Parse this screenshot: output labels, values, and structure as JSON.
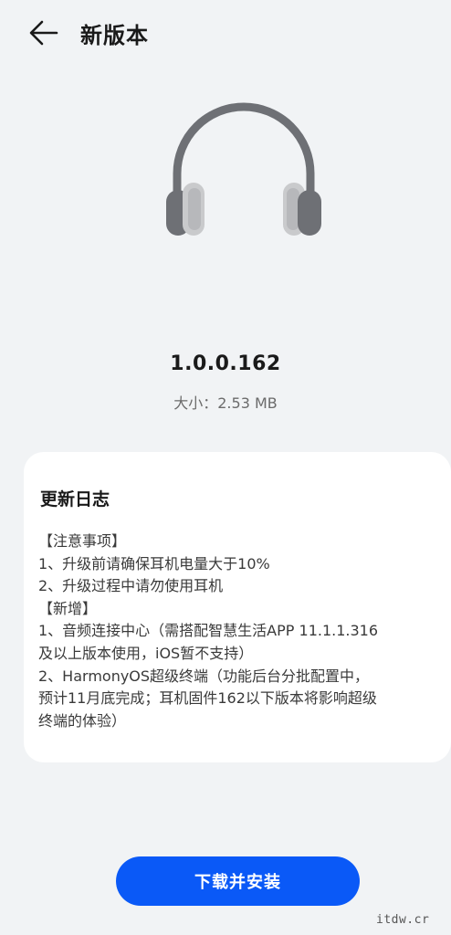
{
  "header": {
    "back_icon": "arrow-left-icon",
    "title": "新版本"
  },
  "hero": {
    "icon": "headphones-icon"
  },
  "release": {
    "version": "1.0.0.162",
    "size_text": "大小：2.53 MB"
  },
  "changelog": {
    "title": "更新日志",
    "lines": [
      "【注意事项】",
      "1、升级前请确保耳机电量大于10%",
      "2、升级过程中请勿使用耳机",
      "【新增】",
      "1、音频连接中心（需搭配智慧生活APP 11.1.1.316",
      "及以上版本使用，iOS暂不支持）",
      "2、HarmonyOS超级终端（功能后台分批配置中，",
      "预计11月底完成；耳机固件162以下版本将影响超级",
      "终端的体验）"
    ]
  },
  "actions": {
    "download_label": "下载并安装"
  },
  "watermark": "itdw.cr",
  "colors": {
    "background": "#f1f3f5",
    "card": "#ffffff",
    "accent": "#0a59f7",
    "headphone_dark": "#6e7075",
    "headphone_light": "#c9cacc"
  }
}
